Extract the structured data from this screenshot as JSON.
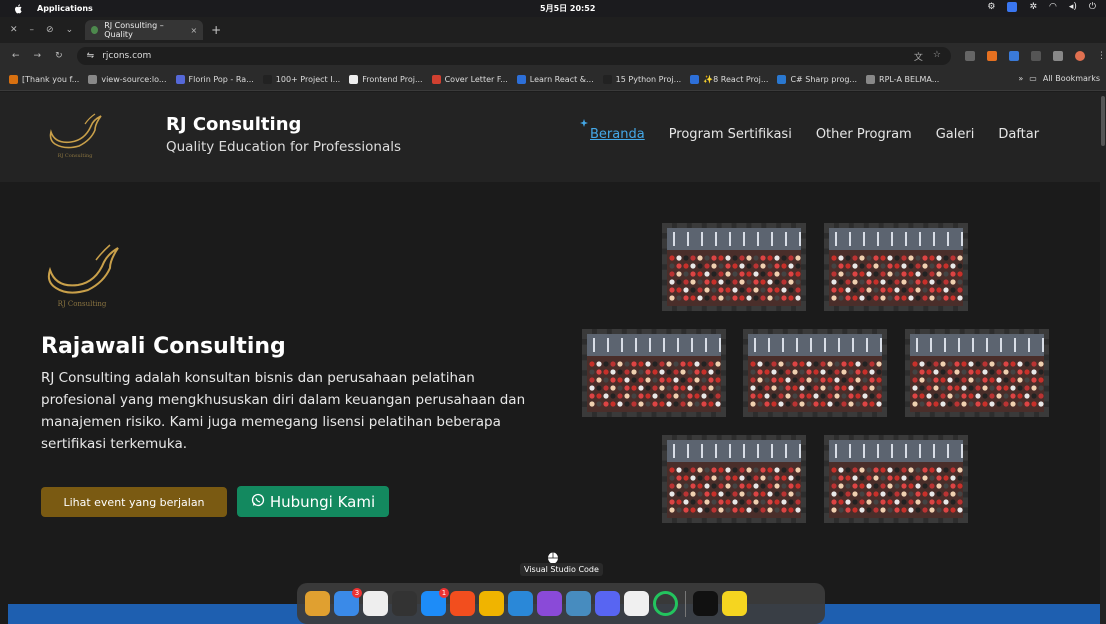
{
  "menubar": {
    "app_label": "Applications",
    "clock": "5月5日 20:52"
  },
  "browser": {
    "tab_title": "RJ Consulting – Quality",
    "new_tab": "+",
    "url": "rjcons.com",
    "bookmarks": [
      {
        "label": "[Thank you f...",
        "color": "#d87010"
      },
      {
        "label": "view-source:lo...",
        "color": "#888888"
      },
      {
        "label": "Florin Pop - Ra...",
        "color": "#5568d8"
      },
      {
        "label": "100+ Project I...",
        "color": "#222222"
      },
      {
        "label": "Frontend Proj...",
        "color": "#eeeeee"
      },
      {
        "label": "Cover Letter F...",
        "color": "#d04030"
      },
      {
        "label": "Learn React &...",
        "color": "#2d6fd8"
      },
      {
        "label": "15 Python Proj...",
        "color": "#222222"
      },
      {
        "label": "✨8 React Proj...",
        "color": "#2d6fd8"
      },
      {
        "label": "C# Sharp prog...",
        "color": "#2a78d0"
      },
      {
        "label": "RPL-A BELMA...",
        "color": "#888888"
      }
    ],
    "more_bookmarks": "»",
    "all_bookmarks": "All Bookmarks"
  },
  "site": {
    "brand_title": "RJ Consulting",
    "brand_subtitle": "Quality Education for Professionals",
    "nav": [
      "Beranda",
      "Program Sertifikasi",
      "Other Program",
      "Galeri",
      "Daftar"
    ],
    "hero_title": "Rajawali Consulting",
    "hero_description": "RJ Consulting adalah konsultan bisnis dan perusahaan pelatihan profesional yang mengkhususkan diri dalam keuangan perusahaan dan manajemen risiko. Kami juga memegang lisensi pelatihan beberapa sertifikasi terkemuka.",
    "btn_event": "Lihat event yang berjalan",
    "btn_contact": "Hubungi Kami",
    "logo_caption": "RJ Consulting"
  },
  "dock": {
    "tooltip": "Visual Studio Code",
    "apps": [
      {
        "name": "launchpad",
        "color": "#e0a030"
      },
      {
        "name": "finder",
        "color": "#3a8ae8",
        "badge": "3"
      },
      {
        "name": "notes",
        "color": "#eeeeee"
      },
      {
        "name": "terminal",
        "color": "#333333"
      },
      {
        "name": "app-store",
        "color": "#1d8cf8",
        "badge": "1"
      },
      {
        "name": "figma",
        "color": "#f24e1e"
      },
      {
        "name": "chrome",
        "color": "#f0b400"
      },
      {
        "name": "vscode",
        "color": "#2a88d8"
      },
      {
        "name": "visual-studio",
        "color": "#8a4ad8"
      },
      {
        "name": "godot",
        "color": "#478cbf"
      },
      {
        "name": "discord",
        "color": "#5865f2"
      },
      {
        "name": "reminders",
        "color": "#f0f0f0"
      },
      {
        "name": "ring-app",
        "color": "#23c45e"
      },
      {
        "name": "intellij",
        "color": "#111111"
      },
      {
        "name": "stickies",
        "color": "#f5d520"
      }
    ]
  }
}
